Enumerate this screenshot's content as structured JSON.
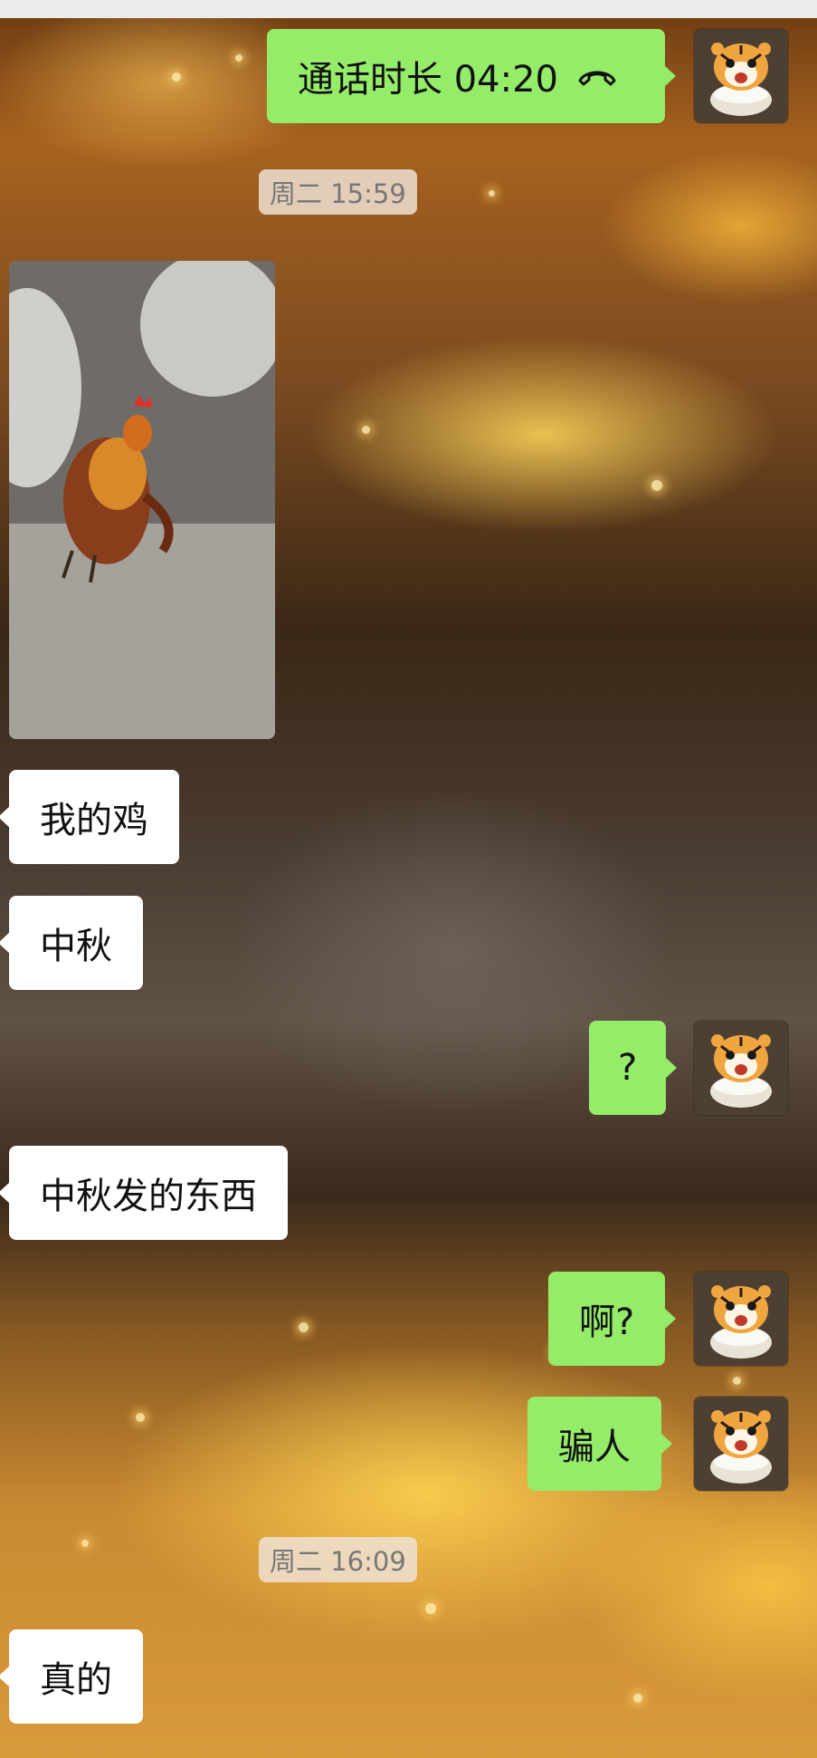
{
  "chat": {
    "call_duration_label": "通话时长 04:20",
    "call_icon": "phone-hangup-icon",
    "timestamps": [
      "周二 15:59",
      "周二 16:09"
    ],
    "messages": [
      {
        "side": "other",
        "text": "我的鸡"
      },
      {
        "side": "other",
        "text": "中秋"
      },
      {
        "side": "me",
        "text": "?"
      },
      {
        "side": "other",
        "text": "中秋发的东西"
      },
      {
        "side": "me",
        "text": "啊?"
      },
      {
        "side": "me",
        "text": "骗人"
      },
      {
        "side": "other",
        "text": "真的"
      }
    ],
    "image_message": {
      "description_icon": "photo-rooster"
    }
  },
  "colors": {
    "my_bubble": "#95ec69",
    "other_bubble": "#ffffff",
    "timestamp_chip": "#eee1d4"
  }
}
